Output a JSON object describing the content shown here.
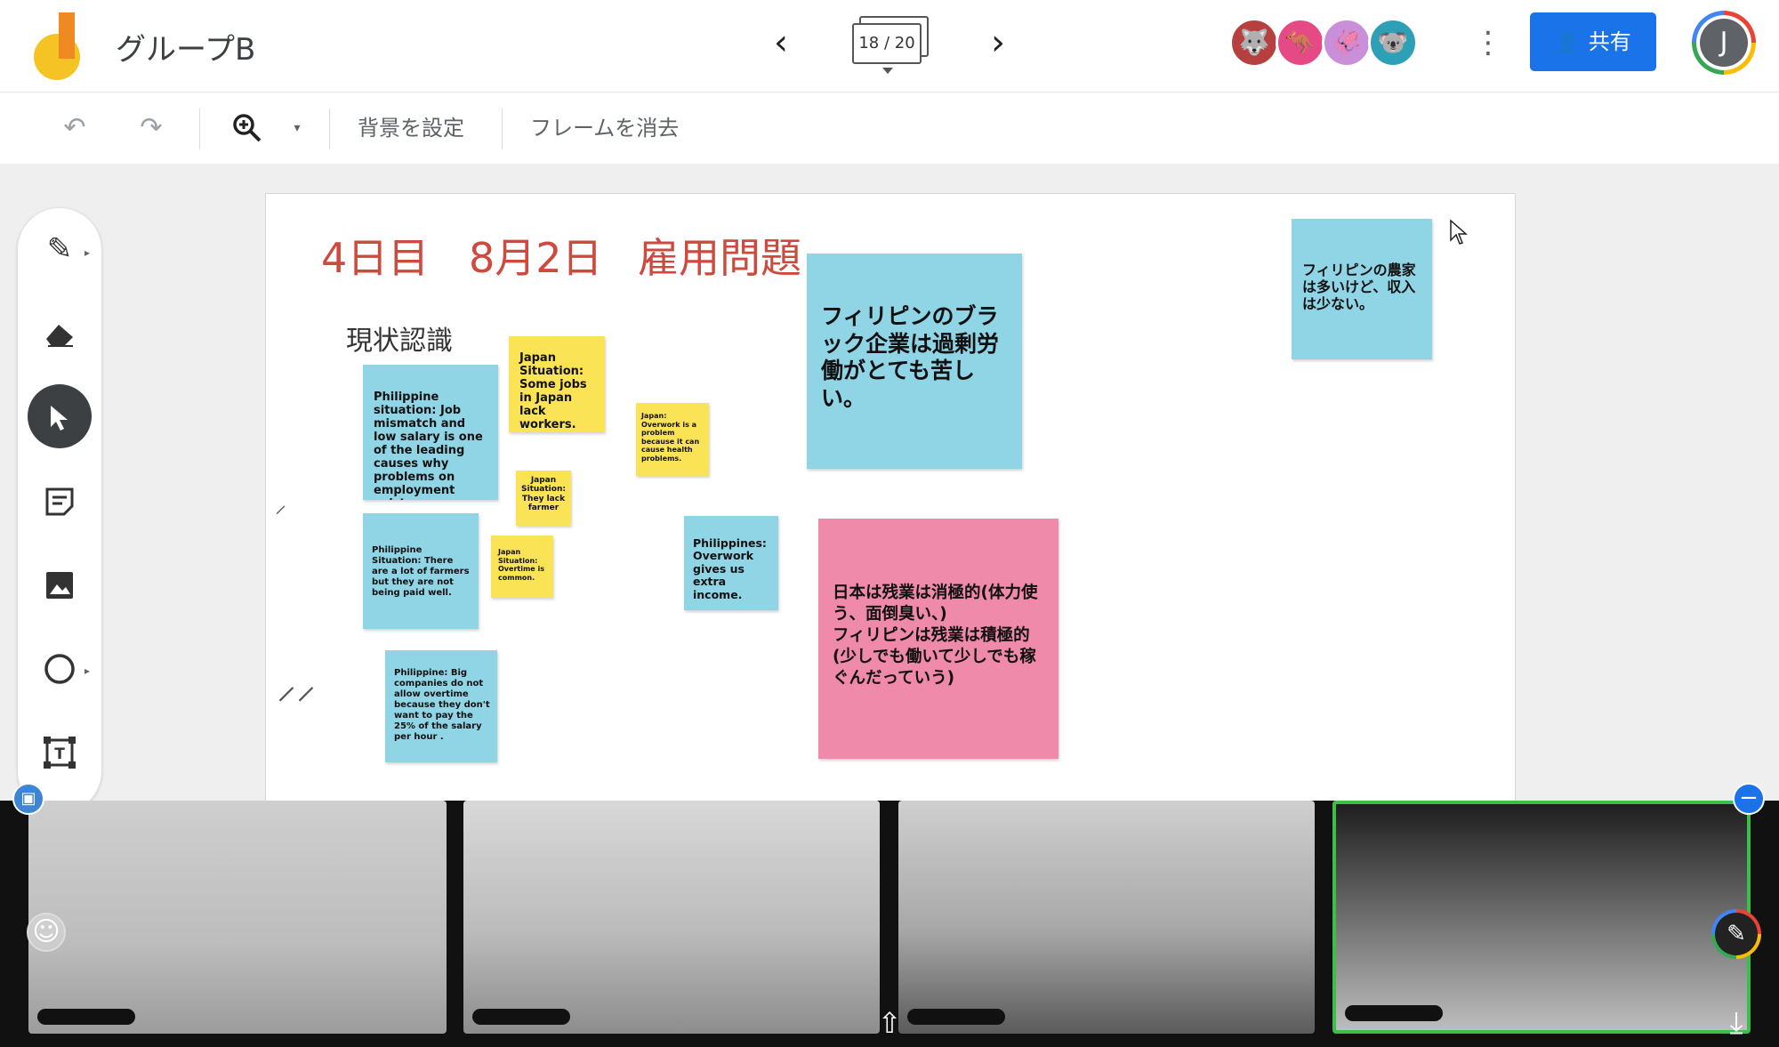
{
  "app": {
    "title": "グループB",
    "frame_counter": "18 / 20",
    "share_label": "共有",
    "account_initial": "J",
    "presence": [
      {
        "icon": "wolf-icon",
        "color": "#b5403f"
      },
      {
        "icon": "kangaroo-icon",
        "color": "#e64a86"
      },
      {
        "icon": "squid-icon",
        "color": "#c98fd8"
      },
      {
        "icon": "koala-icon",
        "color": "#2d9fb7"
      }
    ]
  },
  "toolbar": {
    "set_background": "背景を設定",
    "clear_frame": "フレームを消去"
  },
  "tools": [
    "pen",
    "eraser",
    "select",
    "sticky-note",
    "image",
    "shape",
    "text-box"
  ],
  "canvas": {
    "heading_day": "4日目",
    "heading_date": "8月2日",
    "heading_topic": "雇用問題",
    "subheading": "現状認識",
    "notes": [
      {
        "id": "ph-mismatch",
        "color": "blue",
        "text": "Philippine situation: Job mismatch and low salary is one of the leading causes why problems on employment exists"
      },
      {
        "id": "jp-lack-workers",
        "color": "yellow",
        "text": "Japan Situation: Some jobs in Japan lack workers."
      },
      {
        "id": "jp-overwork",
        "color": "yellow",
        "text": "Japan: Overwork is a problem because it can cause health problems."
      },
      {
        "id": "jp-lack-farmer",
        "color": "yellow",
        "text": "Japan Situation: They lack farmer"
      },
      {
        "id": "ph-farmers",
        "color": "blue",
        "text": "Philippine Situation: There are a lot of farmers but they are not being paid well."
      },
      {
        "id": "jp-overtime",
        "color": "yellow",
        "text": "Japan Situation: Overtime is common."
      },
      {
        "id": "ph-overwork-income",
        "color": "blue",
        "text": "Philippines: Overwork gives us extra income."
      },
      {
        "id": "ph-big-companies",
        "color": "blue",
        "text": "Philippine: Big companies do not allow overtime because they don't want to pay the 25% of the salary per hour ."
      },
      {
        "id": "ph-black-companies",
        "color": "blue",
        "text": "フィリピンのブラック企業は過剰労働がとても苦しい。"
      },
      {
        "id": "ph-farmer-income",
        "color": "blue",
        "text": "フィリピンの農家は多いけど、収入は少ない。"
      },
      {
        "id": "jp-vs-ph-overtime",
        "color": "pink",
        "text": "日本は残業は消極的(体力使う、面倒臭い、)\nフィリピンは残業は積極的(少しでも働いて少しでも稼ぐんだっていう)"
      }
    ]
  },
  "video_participants": 4,
  "colors": {
    "accent": "#1a73e8",
    "heading": "#cd4a3e",
    "note_blue": "#8fd5e6",
    "note_yellow": "#fbe356",
    "note_pink": "#ef8aab",
    "active_speaker": "#3cbf4a"
  }
}
